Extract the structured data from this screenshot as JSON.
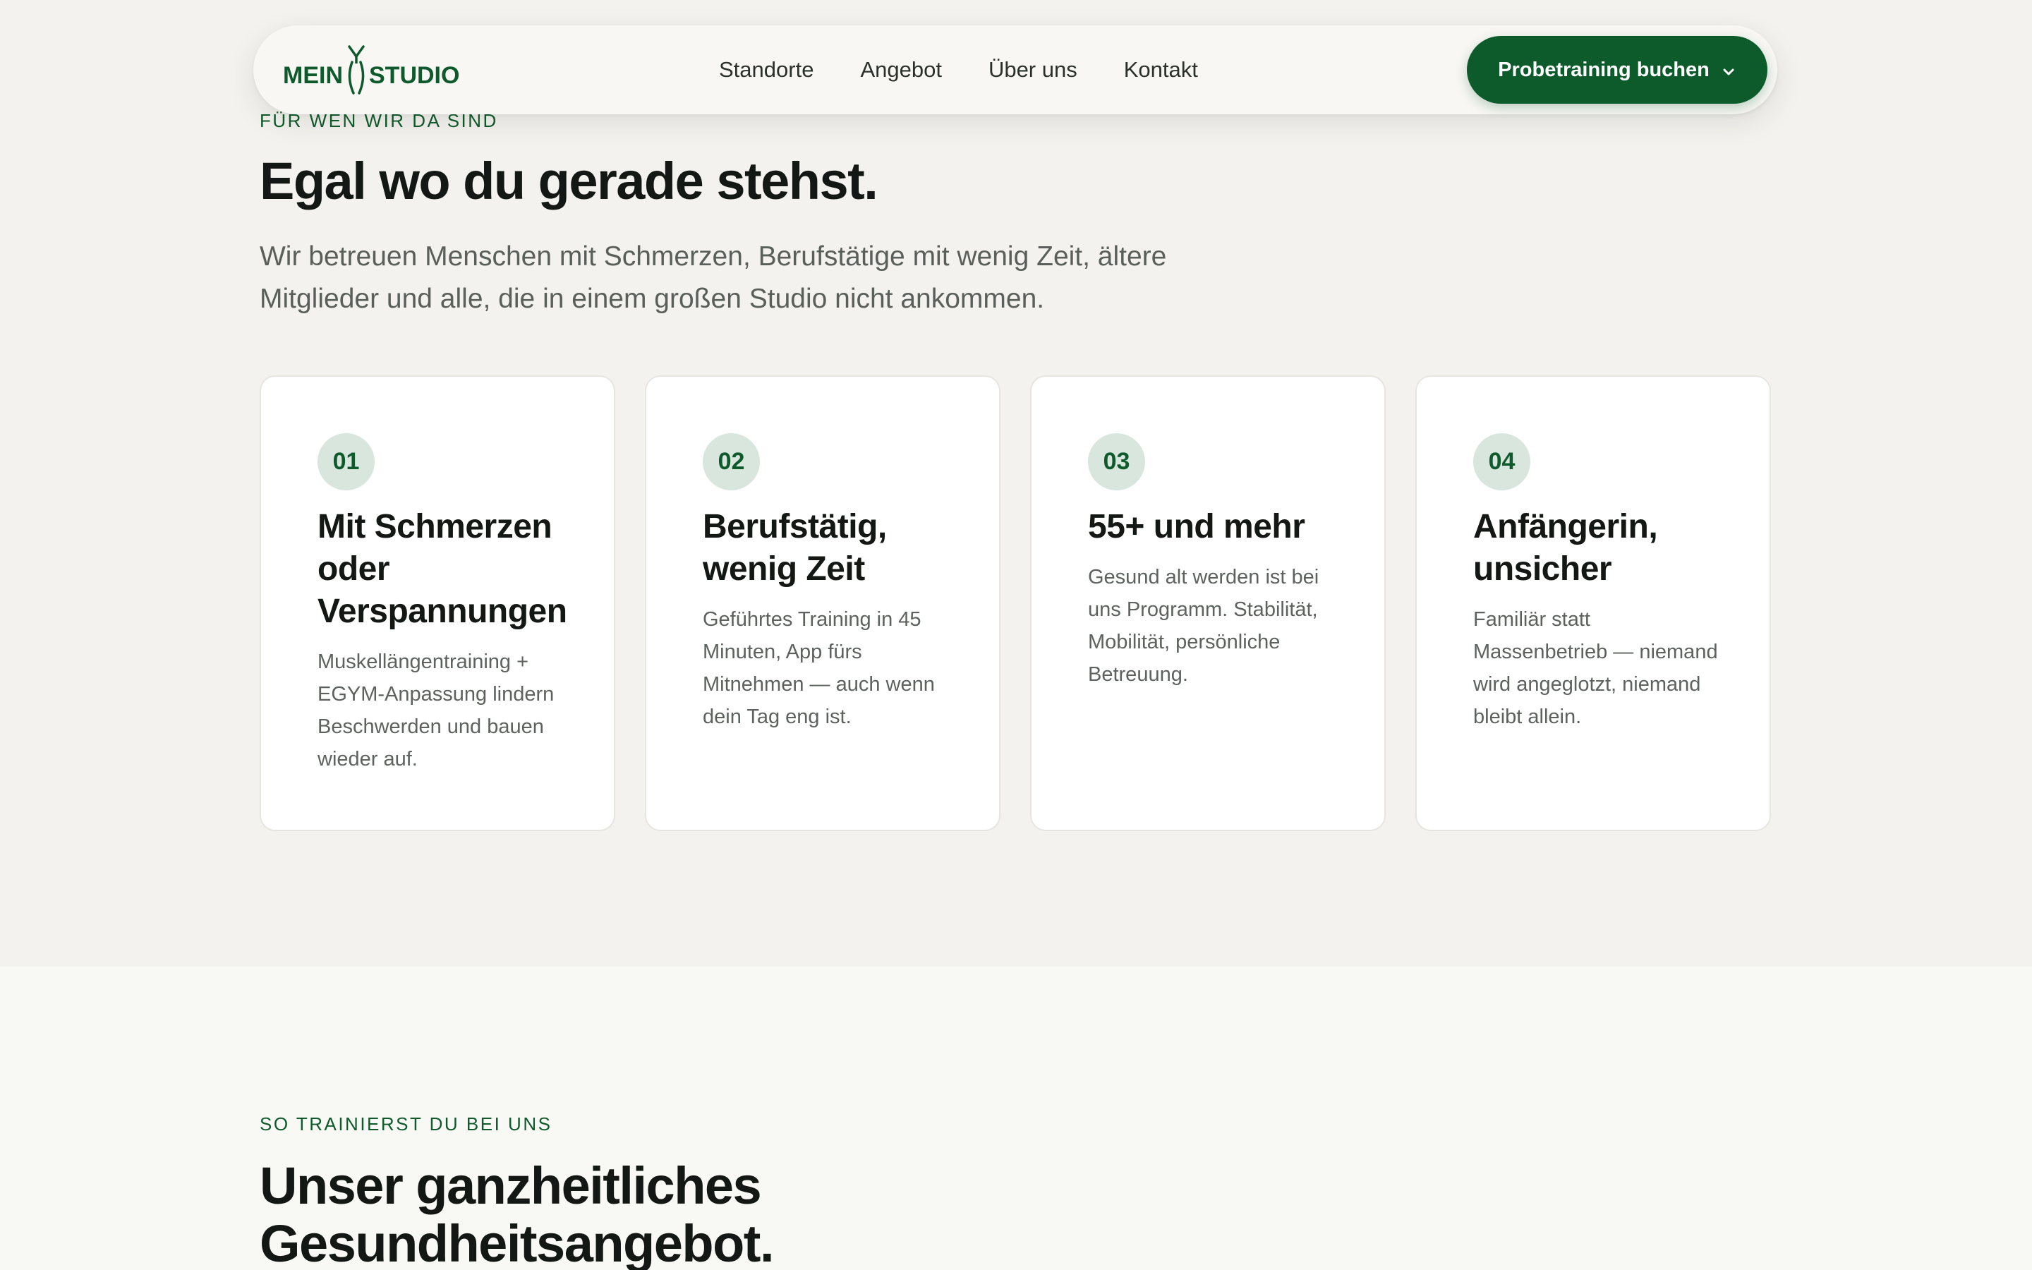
{
  "brand": {
    "logo_left": "MEIN",
    "logo_right": "STUDIO",
    "primary_color": "#0d5a2b",
    "accent_soft": "#d9e6dd"
  },
  "nav": {
    "links": [
      {
        "label": "Standorte"
      },
      {
        "label": "Angebot"
      },
      {
        "label": "Über uns"
      },
      {
        "label": "Kontakt"
      }
    ],
    "cta_label": "Probetraining buchen",
    "cta_icon": "chevron-down-icon"
  },
  "audience": {
    "eyebrow": "Für wen wir da sind",
    "title": "Egal wo du gerade stehst.",
    "lead": "Wir betreuen Menschen mit Schmerzen, Berufstätige mit wenig Zeit, ältere Mitglieder und alle, die in einem großen Studio nicht ankommen.",
    "cards": [
      {
        "number": "01",
        "title": "Mit Schmerzen oder Verspannungen",
        "text": "Muskellängentraining + EGYM-Anpassung lindern Beschwerden und bauen wieder auf."
      },
      {
        "number": "02",
        "title": "Berufstätig, wenig Zeit",
        "text": "Geführtes Training in 45 Minuten, App fürs Mitnehmen — auch wenn dein Tag eng ist."
      },
      {
        "number": "03",
        "title": "55+ und mehr",
        "text": "Gesund alt werden ist bei uns Programm. Stabilität, Mobilität, persönliche Betreuung."
      },
      {
        "number": "04",
        "title": "Anfängerin, unsicher",
        "text": "Familiär statt Massenbetrieb — niemand wird angeglotzt, niemand bleibt allein."
      }
    ]
  },
  "offer": {
    "eyebrow": "So trainierst du bei uns",
    "title": "Unser ganzheitliches Gesundheitsangebot."
  }
}
